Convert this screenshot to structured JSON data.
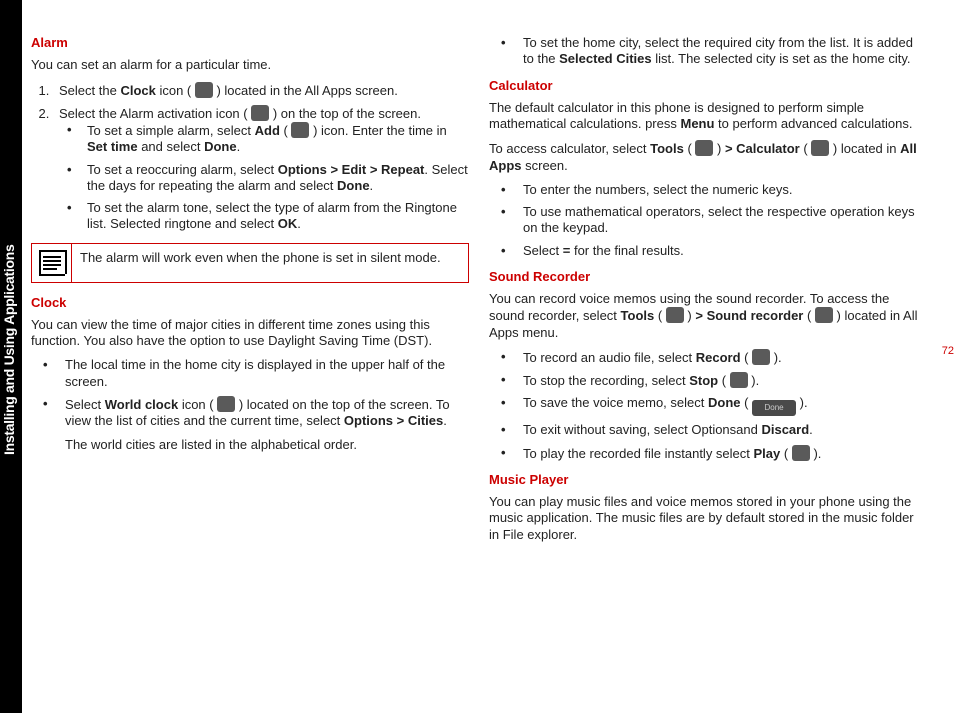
{
  "sidebar_label": "Installing and Using Applications",
  "page_number": "72",
  "left": {
    "alarm": {
      "heading": "Alarm",
      "intro": "You can set an alarm for a particular time.",
      "steps": [
        {
          "pre": "Select the ",
          "b1": "Clock",
          "mid": " icon ( ",
          "post": " ) located in the All Apps screen."
        },
        {
          "pre": "Select the Alarm activation icon ( ",
          "post": " ) on the top of the screen."
        }
      ],
      "bullets": [
        "To set a simple alarm, select <b>Add</b> ( [icon] ) icon. Enter the time in <b>Set time</b> and select <b>Done</b>.",
        "To set a reoccuring alarm, select <b>Options > Edit > Repeat</b>. Select the days for repeating the alarm and select <b>Done</b>.",
        "To set the alarm tone, select the type of alarm from the Ringtone list. Selected ringtone and select <b>OK</b>."
      ],
      "note": "The alarm will work even when the phone is set in silent mode."
    },
    "clock": {
      "heading": "Clock",
      "p1": "You can view the time of major cities in different time zones using this function. You also have the option to use Daylight Saving Time (DST).",
      "b1": "The local time in the home city is displayed in the upper half of the screen.",
      "b2": "Select <b>World clock</b> icon ( [icon] ) located on the top of the screen. To view the list of cities and the current time, select <b>Options > Cities</b>.",
      "p2": "The world cities are listed in the alphabetical order."
    }
  },
  "right": {
    "home_city": "To set the home city, select the required city from the list. It is added to the <b>Selected Cities</b> list. The selected city is set as the home city.",
    "calculator": {
      "heading": "Calculator",
      "p1": "The default calculator in this phone is designed to perform simple mathematical calculations. press <b>Menu</b> to perform advanced calculations.",
      "p2": "To access calculator, select <b>Tools</b> ( [icon] ) <b>> Calculator</b> ( [icon] ) located in <b>All Apps</b> screen.",
      "b1": "To enter the numbers, select the numeric keys.",
      "b2": "To use mathematical operators, select the respective operation keys on the keypad.",
      "b3": "Select <b>=</b> for the final results."
    },
    "recorder": {
      "heading": "Sound Recorder",
      "p1": "You can record voice memos using the sound recorder. To access the sound recorder, select <b>Tools</b> ( [icon] ) <b>> Sound recorder</b> ( [icon] ) located in All Apps menu.",
      "b1": "To record an audio file, select <b>Record</b> ( [icon] ).",
      "b2": "To stop the recording, select <b>Stop</b> ( [icon] ).",
      "b3": "To save the voice memo, select <b>Done</b> ( [done] ).",
      "b4": "To exit without saving, select Optionsand <b>Discard</b>.",
      "b5": "To play the recorded file instantly select <b>Play</b> ( [icon] )."
    },
    "music": {
      "heading": "Music Player",
      "p1": "You can play music files and voice memos stored in your phone using the music application. The music files are by default stored in the music folder in File explorer."
    }
  }
}
